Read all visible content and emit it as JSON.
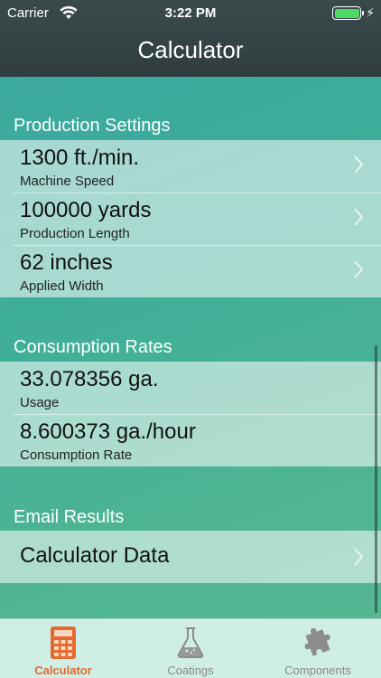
{
  "status_bar": {
    "carrier": "Carrier",
    "time": "3:22 PM"
  },
  "nav": {
    "title": "Calculator"
  },
  "sections": {
    "production": {
      "header": "Production Settings",
      "rows": [
        {
          "value": "1300 ft./min.",
          "caption": "Machine Speed"
        },
        {
          "value": "100000 yards",
          "caption": "Production Length"
        },
        {
          "value": "62 inches",
          "caption": "Applied Width"
        }
      ]
    },
    "consumption": {
      "header": "Consumption Rates",
      "rows": [
        {
          "value": "33.078356 ga.",
          "caption": "Usage"
        },
        {
          "value": "8.600373 ga./hour",
          "caption": "Consumption Rate"
        }
      ]
    },
    "email": {
      "header": "Email Results",
      "rows": [
        {
          "value": "Calculator Data"
        }
      ]
    }
  },
  "tabs": [
    {
      "label": "Calculator",
      "icon": "calculator-icon",
      "active": true
    },
    {
      "label": "Coatings",
      "icon": "flask-icon",
      "active": false
    },
    {
      "label": "Components",
      "icon": "puzzle-piece-icon",
      "active": false
    }
  ],
  "colors": {
    "accent": "#e46a2e",
    "header_bg": "#2f3d3f",
    "battery": "#4cd964",
    "tab_bar_bg": "#cfeee6"
  }
}
